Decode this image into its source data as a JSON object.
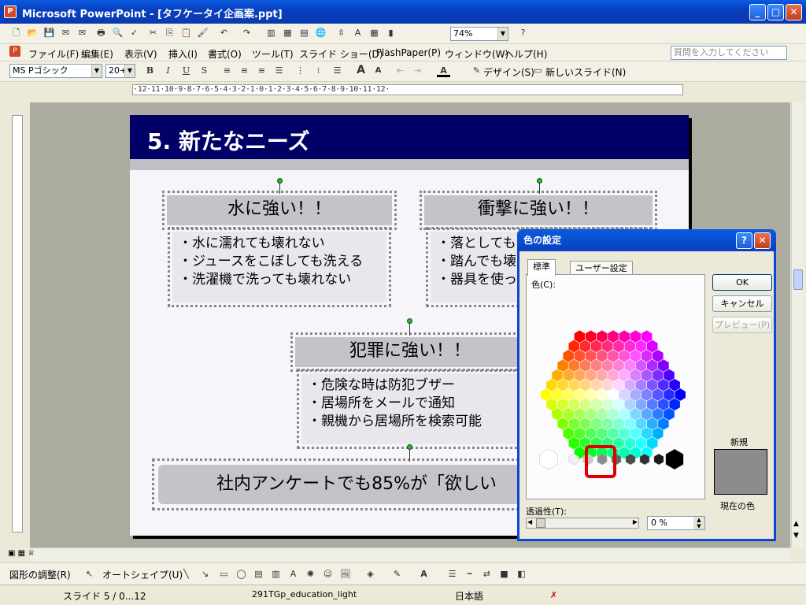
{
  "window": {
    "title": "Microsoft PowerPoint - [タフケータイ企画案.ppt]",
    "help_placeholder": "質問を入力してください"
  },
  "toolbar": {
    "zoom": "74%"
  },
  "menu": [
    "ファイル(F)",
    "編集(E)",
    "表示(V)",
    "挿入(I)",
    "書式(O)",
    "ツール(T)",
    "スライド ショー(D)",
    "FlashPaper(P)",
    "ウィンドウ(W)",
    "ヘルプ(H)"
  ],
  "format": {
    "font": "MS Pゴシック",
    "size": "20+",
    "bold": "B",
    "italic": "I",
    "underline": "U",
    "shadow": "S",
    "design": "デザイン(S)",
    "new_slide": "新しいスライド(N)"
  },
  "ruler": "·12·11·10·9·8·7·6·5·4·3·2·1·0·1·2·3·4·5·6·7·8·9·10·11·12·",
  "slide": {
    "title": "5. 新たなニーズ",
    "box1": {
      "head": "水に強い！！",
      "lines": [
        "・水に濡れても壊れない",
        "・ジュースをこぼしても洗える",
        "・洗濯機で洗っても壊れない"
      ]
    },
    "box2": {
      "head": "衝撃に強い！！",
      "lines": [
        "・落としても",
        "・踏んでも壊",
        "・器具を使っ"
      ]
    },
    "box3": {
      "head": "犯罪に強い！！",
      "lines": [
        "・危険な時は防犯ブザー",
        "・居場所をメールで通知",
        "・親機から居場所を検索可能"
      ]
    },
    "box4": {
      "text": "社内アンケートでも85%が「欲しい"
    }
  },
  "dialog": {
    "title": "色の設定",
    "tab_standard": "標準",
    "tab_custom": "ユーザー設定",
    "color_label": "色(C):",
    "ok": "OK",
    "cancel": "キャンセル",
    "preview": "プレビュー(P)",
    "new_label": "新規",
    "current_label": "現在の色",
    "transparency_label": "透過性(T):",
    "transparency_value": "0 %",
    "new_color": "#8C8C8C"
  },
  "drawbar": {
    "adjust": "図形の調整(R)",
    "autoshape": "オートシェイプ(U)"
  },
  "status": {
    "slide": "スライド 5 / 0...12",
    "design": "291TGp_education_light",
    "language": "日本語"
  }
}
